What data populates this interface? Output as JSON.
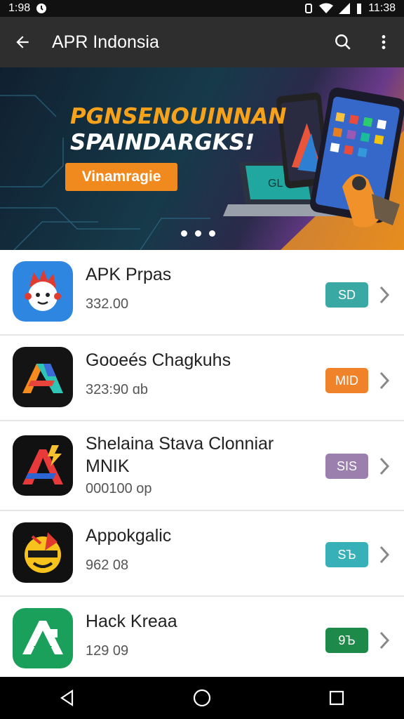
{
  "status": {
    "time_left": "1:98",
    "time_right": "11:38"
  },
  "appbar": {
    "title": "APR Indonsia"
  },
  "banner": {
    "headline_line1": "PGNSENOUINNAN",
    "headline_line2": "SPAINDARGKS!",
    "cta": "Vinamragie",
    "laptop_screen_text": "GL"
  },
  "apps": [
    {
      "name": "APK Prpas",
      "sub": "332.00",
      "badge": "SD",
      "badge_color": "#3aa9a4",
      "icon": "red-mascot-icon"
    },
    {
      "name": "Gooeés Chagkuhs",
      "sub": "323:90  ɑb",
      "badge": "MID",
      "badge_color": "#f0822a",
      "icon": "colorful-a-icon"
    },
    {
      "name": "Shelaina Stava Clonniar MNIK",
      "sub": "000100 op",
      "badge": "SIS",
      "badge_color": "#9b80ad",
      "icon": "red-a-lightning-icon"
    },
    {
      "name": "Appokgalic",
      "sub": "962 08",
      "badge": "SЪ",
      "badge_color": "#37b0b7",
      "icon": "yellow-face-icon"
    },
    {
      "name": "Hack Kreaa",
      "sub": "129 09",
      "badge": "9Ъ",
      "badge_color": "#1e8a4a",
      "icon": "green-a-icon"
    }
  ]
}
